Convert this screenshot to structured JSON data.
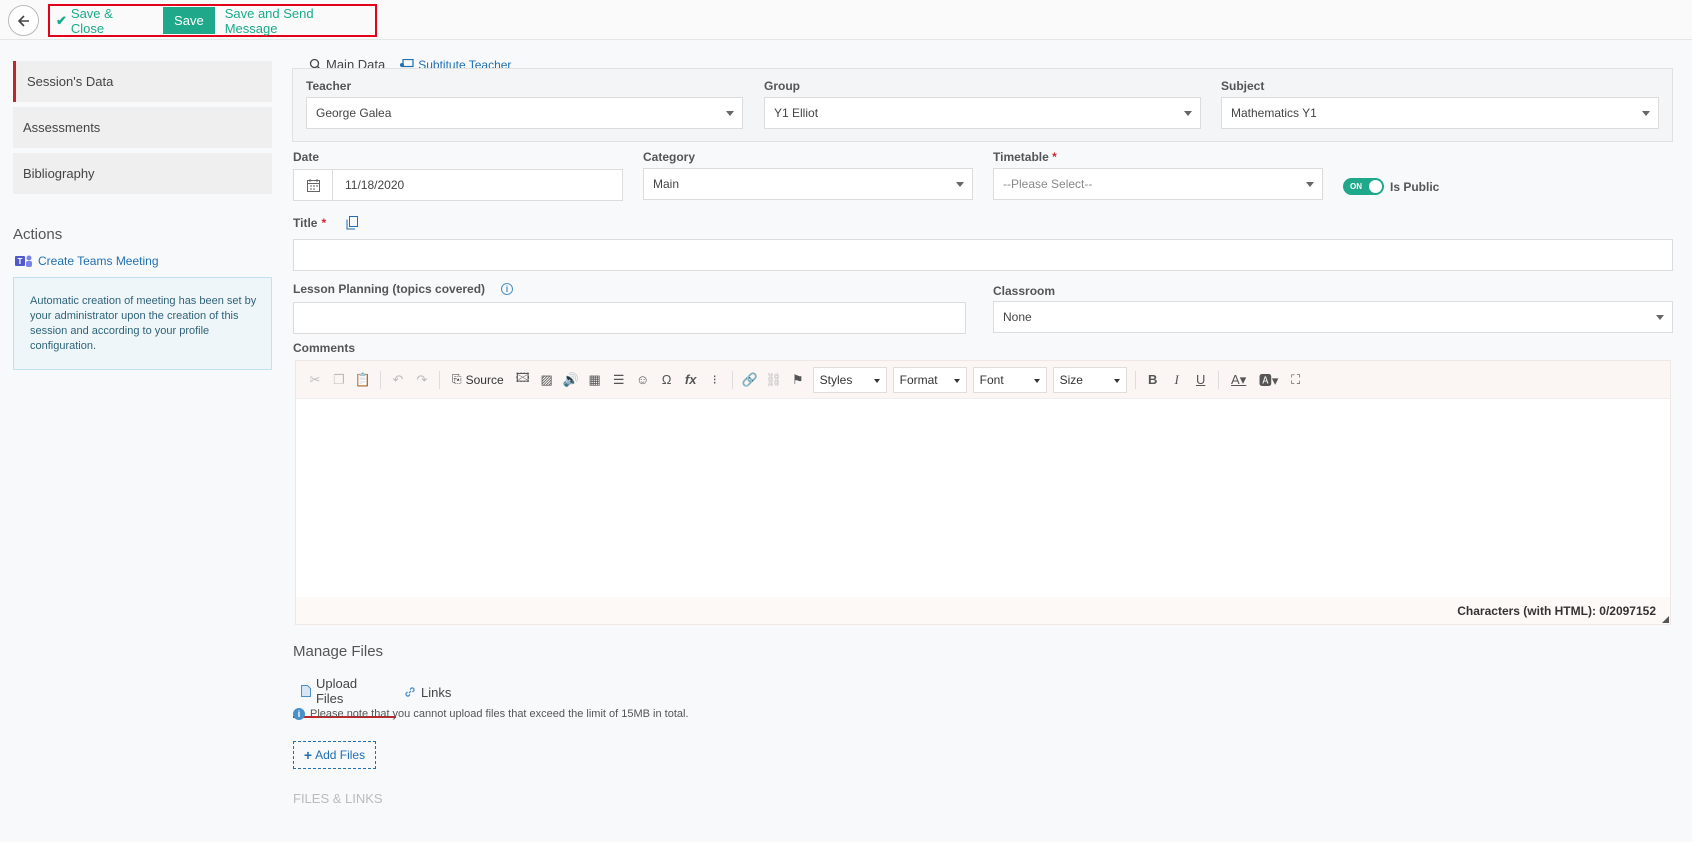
{
  "toolbar": {
    "save_close": "Save & Close",
    "save": "Save",
    "save_send": "Save and Send Message"
  },
  "sidebar": {
    "items": [
      {
        "label": "Session's Data"
      },
      {
        "label": "Assessments"
      },
      {
        "label": "Bibliography"
      }
    ],
    "actions_title": "Actions",
    "teams_link": "Create Teams Meeting",
    "info_text": "Automatic creation of meeting has been set by your administrator upon the creation of this session and according to your profile configuration."
  },
  "main": {
    "tabs": {
      "main_data": "Main Data",
      "substitute": "Subtitute Teacher"
    },
    "teacher": {
      "label": "Teacher",
      "value": "George Galea"
    },
    "group": {
      "label": "Group",
      "value": "Y1 Elliot"
    },
    "subject": {
      "label": "Subject",
      "value": "Mathematics Y1"
    },
    "date": {
      "label": "Date",
      "value": "11/18/2020"
    },
    "category": {
      "label": "Category",
      "value": "Main"
    },
    "timetable": {
      "label": "Timetable",
      "placeholder": "--Please Select--"
    },
    "is_public": {
      "toggle_text": "ON",
      "label": "Is Public"
    },
    "title": {
      "label": "Title"
    },
    "lesson_planning": {
      "label": "Lesson Planning (topics covered)"
    },
    "classroom": {
      "label": "Classroom",
      "value": "None"
    },
    "comments": {
      "label": "Comments"
    }
  },
  "editor": {
    "source": "Source",
    "styles": "Styles",
    "format": "Format",
    "font": "Font",
    "size": "Size",
    "char_count": "Characters (with HTML): 0/2097152"
  },
  "files": {
    "title": "Manage Files",
    "upload_tab": "Upload Files",
    "links_tab": "Links",
    "note": "Please note that you cannot upload files that exceed the limit of 15MB in total.",
    "add_files": "Add Files",
    "files_links": "FILES & LINKS"
  },
  "colors": {
    "accent": "#1fa88a",
    "highlight_border": "#e3001b",
    "link": "#1f6fb2"
  }
}
